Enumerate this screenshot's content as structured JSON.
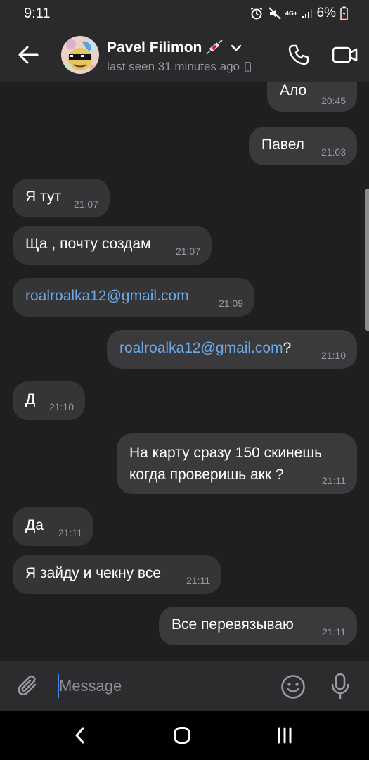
{
  "status_bar": {
    "time": "9:11",
    "network_top": "4G+",
    "battery": "6%"
  },
  "header": {
    "contact_name": "Pavel Filimon",
    "last_seen": "last seen 31 minutes ago"
  },
  "messages": [
    {
      "direction": "out",
      "text": "Ало",
      "time": "20:45"
    },
    {
      "direction": "out",
      "text": "Павел",
      "time": "21:03"
    },
    {
      "direction": "in",
      "text": "Я тут",
      "time": "21:07"
    },
    {
      "direction": "in",
      "text": "Ща , почту создам",
      "time": "21:07"
    },
    {
      "direction": "in",
      "link": "roalroalka12@gmail.com",
      "text": "",
      "time": "21:09"
    },
    {
      "direction": "out",
      "link": "roalroalka12@gmail.com",
      "text": "?",
      "time": "21:10"
    },
    {
      "direction": "in",
      "text": "Д",
      "time": "21:10"
    },
    {
      "direction": "out",
      "text": "На карту сразу 150 скинешь\nкогда проверишь акк ?",
      "time": "21:11"
    },
    {
      "direction": "in",
      "text": "Да",
      "time": "21:11"
    },
    {
      "direction": "in",
      "text": "Я зайду и чекну все",
      "time": "21:11"
    },
    {
      "direction": "out",
      "text": "Все перевязываю",
      "time": "21:11"
    }
  ],
  "composer": {
    "placeholder": "Message"
  },
  "colors": {
    "background": "#1f1f21",
    "bubble": "#3a3a3d",
    "link": "#6aa8e6",
    "time": "#9a9a9e",
    "caret": "#3d8cf0"
  },
  "icons": {
    "back": "arrow-left-icon",
    "call": "phone-icon",
    "video": "video-camera-icon",
    "attach": "paperclip-icon",
    "emoji": "smiley-icon",
    "mic": "microphone-icon"
  }
}
